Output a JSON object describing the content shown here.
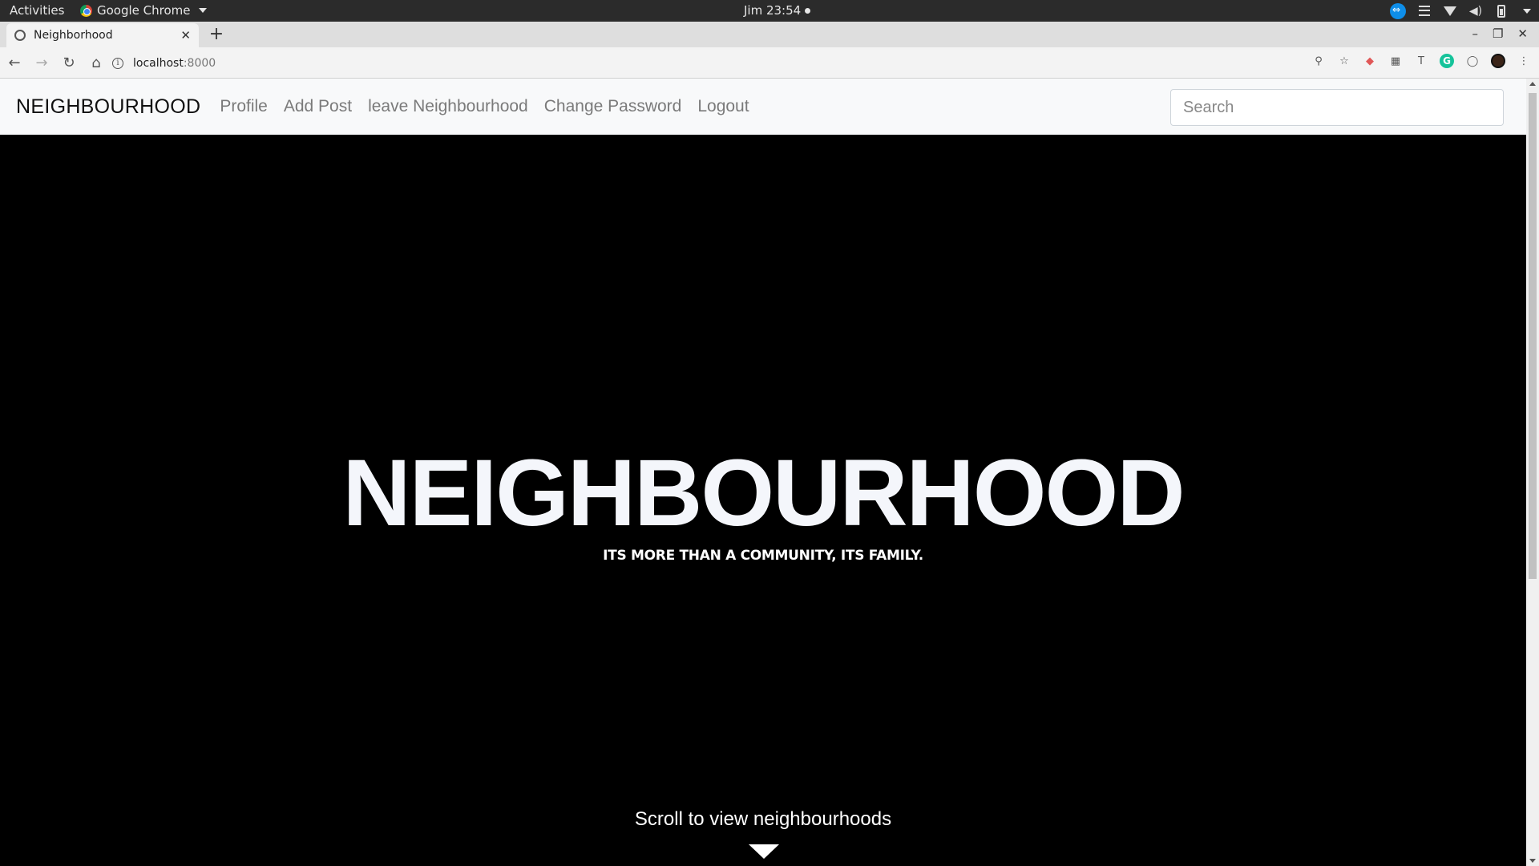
{
  "system_bar": {
    "activities": "Activities",
    "app_name": "Google Chrome",
    "clock": "Jim 23:54"
  },
  "browser": {
    "tab_title": "Neighborhood",
    "url_host": "localhost",
    "url_port": ":8000"
  },
  "navbar": {
    "brand": "NEIGHBOURHOOD",
    "links": [
      "Profile",
      "Add Post",
      "leave Neighbourhood",
      "Change Password",
      "Logout"
    ],
    "search_placeholder": "Search"
  },
  "hero": {
    "title": "NEIGHBOURHOOD",
    "subtitle": "ITS MORE THAN A COMMUNITY, ITS FAMILY.",
    "scroll_text": "Scroll to view neighbourhoods"
  },
  "icons": {
    "tray": [
      "teamviewer-icon",
      "notes-icon",
      "wifi-icon",
      "volume-icon",
      "battery-icon",
      "system-menu-chevron-icon"
    ],
    "extensions": [
      "zoom-icon",
      "star-icon",
      "extension-red-icon",
      "extension-es-icon",
      "extension-t-icon",
      "grammarly-icon",
      "extension-circle-icon",
      "profile-avatar-icon",
      "menu-dots-icon"
    ]
  },
  "colors": {
    "page_background": "#000000",
    "navbar_background": "#f8f9fa",
    "hero_text": "#f4f6fb",
    "nav_link": "#7a7a7a"
  }
}
